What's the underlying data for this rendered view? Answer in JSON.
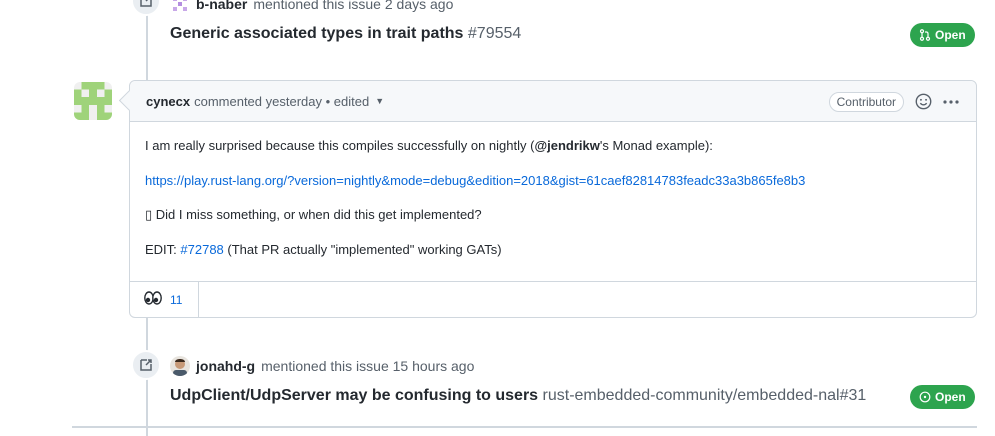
{
  "event1": {
    "actor": "b-naber",
    "text": "mentioned this issue 2 days ago",
    "ref_title": "Generic associated types in trait paths",
    "ref_number": "#79554",
    "state": "Open",
    "state_icon": "pull-request-icon"
  },
  "comment": {
    "author": "cynecx",
    "meta": "commented yesterday • edited",
    "role_label": "Contributor",
    "body": {
      "p1_pre": "I am really surprised because this compiles successfully on nightly (",
      "p1_mention": "@jendrikw",
      "p1_post": "'s Monad example):",
      "p2_link": "https://play.rust-lang.org/?version=nightly&mode=debug&edition=2018&gist=61caef82814783feadc33a3b865fe8b3",
      "p3": "▯ Did I miss something, or when did this get implemented?",
      "p4_pre": "EDIT: ",
      "p4_link": "#72788",
      "p4_post": " (That PR actually \"implemented\" working GATs)"
    },
    "reaction": {
      "icon": "eyes-icon",
      "count": "11"
    }
  },
  "event2": {
    "actor": "jonahd-g",
    "text": "mentioned this issue 15 hours ago",
    "ref_title": "UdpClient/UdpServer may be confusing to users",
    "ref_number": "rust-embedded-community/embedded-nal#31",
    "state": "Open",
    "state_icon": "issue-open-icon"
  },
  "colors": {
    "open_green": "#2da44e",
    "link_blue": "#0969da",
    "border": "#d0d7de",
    "header_bg": "#f6f8fa",
    "muted_text": "#57606a"
  }
}
